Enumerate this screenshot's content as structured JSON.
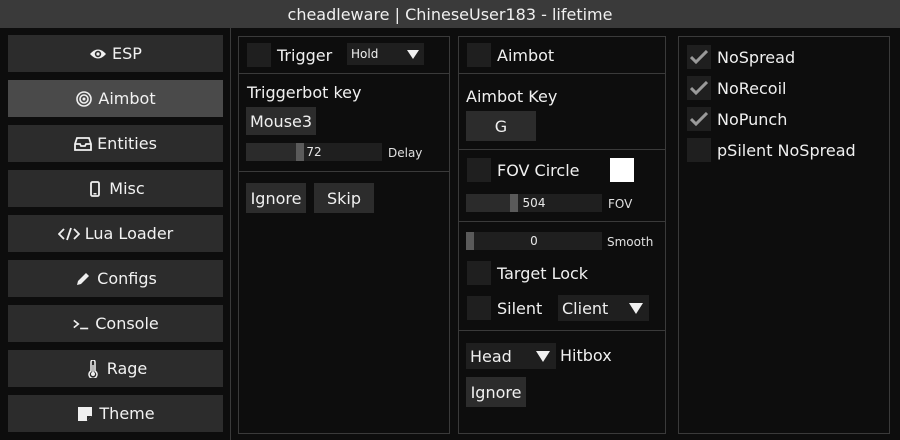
{
  "window": {
    "title": "cheadleware | ChineseUser183 - lifetime"
  },
  "sidebar": {
    "items": [
      {
        "label": "ESP",
        "icon": "eye-icon"
      },
      {
        "label": "Aimbot",
        "icon": "target-icon",
        "active": true
      },
      {
        "label": "Entities",
        "icon": "inbox-icon"
      },
      {
        "label": "Misc",
        "icon": "mobile-icon"
      },
      {
        "label": "Lua Loader",
        "icon": "code-icon"
      },
      {
        "label": "Configs",
        "icon": "pencil-icon"
      },
      {
        "label": "Console",
        "icon": "terminal-icon"
      },
      {
        "label": "Rage",
        "icon": "thermometer-icon"
      },
      {
        "label": "Theme",
        "icon": "sticky-note-icon"
      }
    ]
  },
  "triggerbot": {
    "trigger_label": "Trigger",
    "trigger_checked": false,
    "mode_value": "Hold",
    "key_label": "Triggerbot key",
    "key_value": "Mouse3",
    "delay_value": "72",
    "delay_fraction": 0.39,
    "delay_label": "Delay",
    "ignore_label": "Ignore",
    "skip_label": "Skip"
  },
  "aimbot": {
    "enable_label": "Aimbot",
    "enable_checked": false,
    "key_label": "Aimbot Key",
    "key_value": "G",
    "fov_circle_label": "FOV Circle",
    "fov_circle_checked": false,
    "fov_circle_color": "#ffffff",
    "fov_value": "504",
    "fov_fraction": 0.34,
    "fov_label": "FOV",
    "smooth_value": "0",
    "smooth_fraction": 0.0,
    "smooth_label": "Smooth",
    "target_lock_label": "Target Lock",
    "target_lock_checked": false,
    "silent_label": "Silent",
    "silent_checked": false,
    "silent_mode_value": "Client",
    "hitbox_value": "Head",
    "hitbox_label": "Hitbox",
    "ignore_label": "Ignore"
  },
  "removals": {
    "items": [
      {
        "label": "NoSpread",
        "checked": true
      },
      {
        "label": "NoRecoil",
        "checked": true
      },
      {
        "label": "NoPunch",
        "checked": true
      },
      {
        "label": "pSilent NoSpread",
        "checked": false
      }
    ]
  },
  "colors": {
    "background": "#0d0d0d",
    "titlebar": "#3a3a3a",
    "tab": "#2c2c2c",
    "tab_active": "#4a4a4a",
    "border": "#3a3a3a"
  }
}
